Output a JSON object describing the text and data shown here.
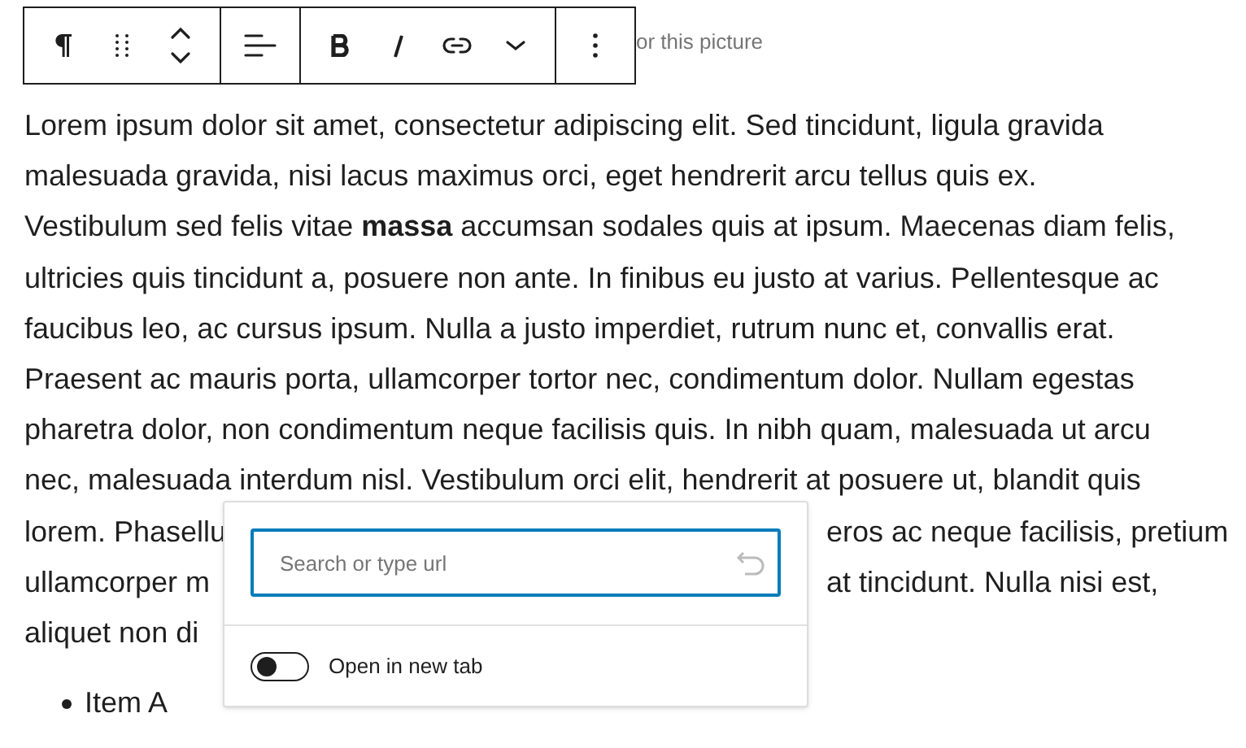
{
  "toolbar": {
    "groups": [
      {
        "buttons": [
          {
            "kind": "paragraph"
          },
          {
            "kind": "drag"
          },
          {
            "kind": "move"
          }
        ]
      },
      {
        "buttons": [
          {
            "kind": "align"
          }
        ]
      },
      {
        "buttons": [
          {
            "kind": "bold"
          },
          {
            "kind": "italic"
          },
          {
            "kind": "link"
          },
          {
            "kind": "more-formats"
          }
        ]
      },
      {
        "buttons": [
          {
            "kind": "options"
          }
        ]
      }
    ]
  },
  "caption_fragment": "or this picture",
  "paragraph": {
    "lines": [
      {
        "text": "Lorem ipsum dolor sit amet, consectetur adipiscing elit. Sed tincidunt, ligula gravida"
      },
      {
        "text": "malesuada gravida, nisi lacus maximus orci, eget hendrerit arcu tellus quis ex."
      },
      {
        "text": "Vestibulum sed felis vitae **massa** accumsan sodales quis at ipsum. Maecenas diam felis,"
      },
      {
        "text": "ultricies quis tincidunt a, posuere non ante. In finibus eu justo at varius. Pellentesque ac"
      },
      {
        "text": "faucibus leo, ac cursus ipsum. Nulla a justo imperdiet, rutrum nunc et, convallis erat."
      },
      {
        "text": "Praesent ac mauris porta, ullamcorper tortor nec, condimentum dolor. Nullam egestas"
      },
      {
        "text": "pharetra dolor, non condimentum neque facilisis quis. In nibh quam, malesuada ut arcu"
      },
      {
        "text": "nec, malesuada interdum nisl. Vestibulum orci elit, hendrerit at posuere ut, blandit quis"
      },
      {
        "text": "lorem. Phasellu",
        "text_right": "eros ac neque facilisis, pretium"
      },
      {
        "text": "ullamcorper m",
        "text_right": "at tincidunt. Nulla nisi est,"
      },
      {
        "text": "aliquet non di"
      }
    ]
  },
  "link_popover": {
    "placeholder": "Search or type url",
    "toggle": {
      "label": "Open in new tab",
      "on": false
    }
  },
  "list": [
    "Item A"
  ]
}
